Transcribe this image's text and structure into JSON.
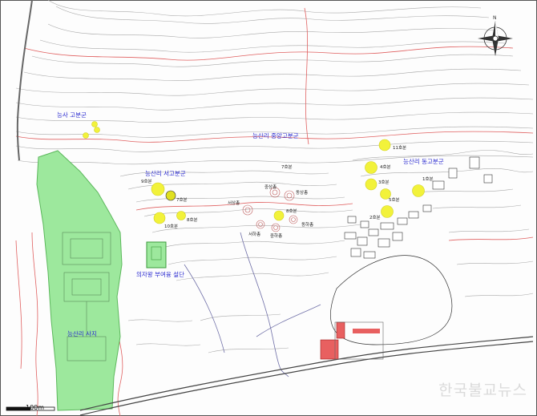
{
  "labels": {
    "tomb_group_ansa": "능사 고분군",
    "tomb_group_west": "능산리 서고분군",
    "tomb_group_central": "능산리 중앙고분군",
    "tomb_group_east": "능산리 동고분군",
    "altar": "의자왕 부여융 설단",
    "temple_site": "능산리 사지"
  },
  "west_tombs": {
    "t9": "9호분",
    "t7": "7호분",
    "t8": "8호분",
    "t10": "10호분"
  },
  "central_tombs": {
    "t7": "7호분",
    "jungsang": "중상총",
    "dongsang": "동상총",
    "seosang": "서상총",
    "t8": "8호분",
    "seoha": "서하총",
    "jungha": "중하총",
    "dongha": "동하총"
  },
  "east_tombs": {
    "t11": "11호분",
    "t4": "4호분",
    "t3": "3호분",
    "t5": "5호분",
    "t1": "1호분",
    "t2": "2호분"
  },
  "scale_label": "100m",
  "watermark": "한국불교뉴스",
  "colors": {
    "contour": "#9a9a9a",
    "index_contour": "#e06060",
    "tomb_marker": "#f2f23a",
    "temple_area": "#9de89d",
    "label_blue": "#2a2ad0"
  }
}
